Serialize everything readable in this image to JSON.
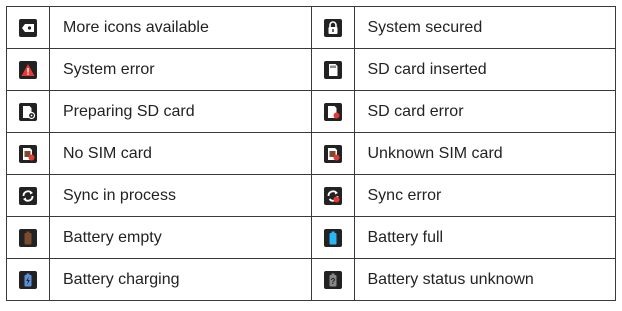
{
  "rows": [
    {
      "left": {
        "icon": "more-icons-icon",
        "label": "More icons available"
      },
      "right": {
        "icon": "system-secured-icon",
        "label": "System secured"
      }
    },
    {
      "left": {
        "icon": "system-error-icon",
        "label": "System error"
      },
      "right": {
        "icon": "sd-card-inserted-icon",
        "label": "SD card inserted"
      }
    },
    {
      "left": {
        "icon": "preparing-sd-card-icon",
        "label": "Preparing SD card"
      },
      "right": {
        "icon": "sd-card-error-icon",
        "label": "SD card error"
      }
    },
    {
      "left": {
        "icon": "no-sim-card-icon",
        "label": "No SIM card"
      },
      "right": {
        "icon": "unknown-sim-card-icon",
        "label": "Unknown SIM card"
      }
    },
    {
      "left": {
        "icon": "sync-in-process-icon",
        "label": "Sync in process"
      },
      "right": {
        "icon": "sync-error-icon",
        "label": "Sync error"
      }
    },
    {
      "left": {
        "icon": "battery-empty-icon",
        "label": "Battery empty"
      },
      "right": {
        "icon": "battery-full-icon",
        "label": "Battery full"
      }
    },
    {
      "left": {
        "icon": "battery-charging-icon",
        "label": "Battery charging"
      },
      "right": {
        "icon": "battery-unknown-icon",
        "label": "Battery status unknown"
      }
    }
  ],
  "colors": {
    "icon_bg": "#222222",
    "icon_fg": "#ffffff",
    "accent_red": "#e53935",
    "accent_cyan": "#29b6f6",
    "accent_brown": "#7a4b2c",
    "accent_blue": "#5c8fd6"
  }
}
